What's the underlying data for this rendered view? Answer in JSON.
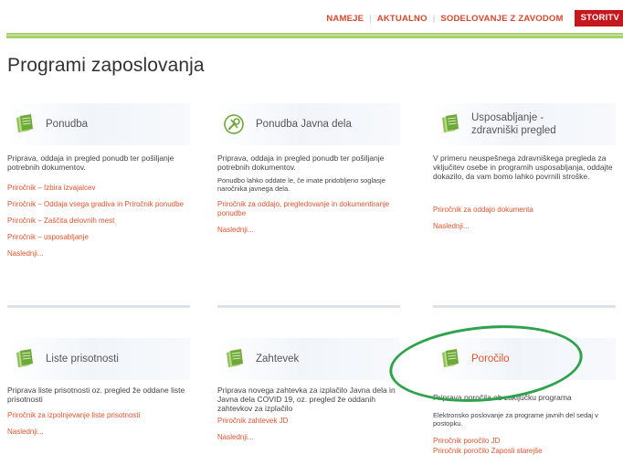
{
  "topnav": {
    "items": [
      "NAMEJE",
      "AKTUALNO",
      "SODELOVANJE Z ZAVODOM"
    ],
    "button": "STORITV"
  },
  "page_title": "Programi zaposlovanja",
  "cards": [
    {
      "title": "Ponudba",
      "icon": "document-icon",
      "description": "Priprava, oddaja in pregled ponudb ter pošiljanje potrebnih dokumentov.",
      "links": [
        "Priročnik – Izbira izvajalcev",
        "Priročnik – Oddaja vsega gradiva in Priročnik ponudbe",
        "Priročnik – Zaščita delovnih mest",
        "Priročnik – usposabljanje",
        "Naslednji..."
      ]
    },
    {
      "title": "Ponudba Javna dela",
      "icon": "tools-icon",
      "description": "Priprava, oddaja in pregled ponudb ter pošiljanje potrebnih dokumentov.",
      "note": "Ponudbo lahko oddate le, če imate pridobljeno soglasje naročnika javnega dela.",
      "links": [
        "Priročnik za oddajo, pregledovanje in dokumentiranje ponudbe",
        "Naslednji..."
      ]
    },
    {
      "title": "Usposabljanje - zdravniški pregled",
      "icon": "document-icon",
      "description": "V primeru neuspešnega zdravniškega pregleda za vključitev osebe in programih usposabljanja, oddajte dokazilo, da vam bomo lahko povrnili stroške.",
      "links": [
        "Priročnik za oddajo dokumenta",
        "Naslednji..."
      ]
    },
    {
      "title": "Liste prisotnosti",
      "icon": "document-icon",
      "description": "Priprava liste prisotnosti oz. pregled že oddane liste prisotnosti",
      "links": [
        "Priročnik za izpolnjevanje liste prisotnosti",
        "Naslednji..."
      ]
    },
    {
      "title": "Zahtevek",
      "icon": "document-icon",
      "description": "Priprava novega zahtevka za izplačilo Javna dela in Javna dela COVID 19, oz. pregled že oddanih zahtevkov za izplačilo",
      "links": [
        "Priročnik zahtevek JD",
        "Naslednji..."
      ]
    },
    {
      "title": "Poročilo",
      "icon": "document-icon",
      "description": "Priprava poročila ob zaključku programa",
      "note": "Elektronsko poslovanje za programe javnih del sedaj v postopku.",
      "links": [
        "Priročnik poročilo JD",
        "Priročnik poročilo Zaposli starejše"
      ]
    }
  ],
  "colors": {
    "accent": "#d9472b",
    "green_bar": "#a9cf6d",
    "highlight_ellipse": "#2fa34b",
    "button_red": "#c8161d"
  }
}
